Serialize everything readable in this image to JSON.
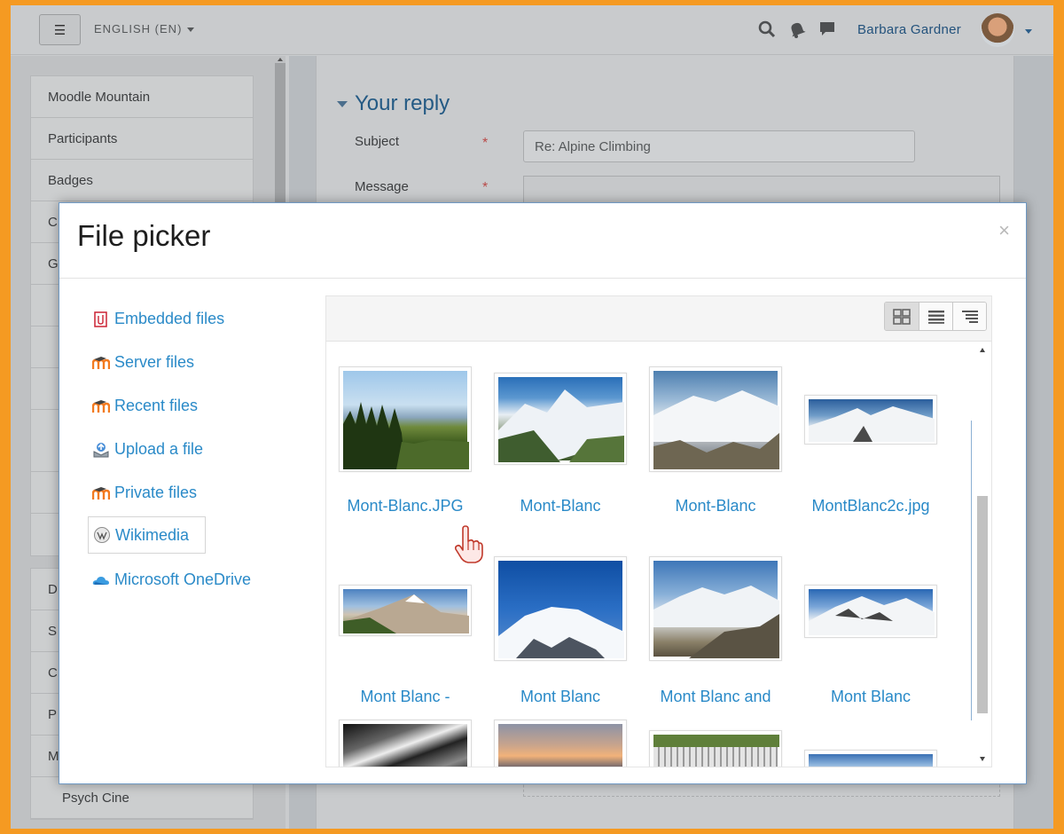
{
  "navbar": {
    "menu_icon": "hamburger-icon",
    "language": "ENGLISH (EN)",
    "icons": [
      "search-icon",
      "bell-icon",
      "chat-icon"
    ],
    "username": "Barbara Gardner"
  },
  "drawer": {
    "items": [
      "Moodle Mountain",
      "Participants",
      "Badges",
      "C",
      "G",
      "",
      "",
      "",
      ""
    ],
    "items2": [
      "D",
      "S",
      "C",
      "P",
      "M",
      "Psych Cine"
    ]
  },
  "form": {
    "section_title": "Your reply",
    "subject_label": "Subject",
    "subject_value": "Re: Alpine Climbing",
    "message_label": "Message",
    "required_marker": "*"
  },
  "modal": {
    "title": "File picker",
    "close_label": "×",
    "repositories": [
      {
        "label": "Embedded files",
        "icon": "embedded-files-icon"
      },
      {
        "label": "Server files",
        "icon": "moodle-icon"
      },
      {
        "label": "Recent files",
        "icon": "moodle-icon"
      },
      {
        "label": "Upload a file",
        "icon": "upload-icon"
      },
      {
        "label": "Private files",
        "icon": "moodle-icon"
      },
      {
        "label": "Wikimedia",
        "icon": "wikimedia-icon"
      },
      {
        "label": "Microsoft OneDrive",
        "icon": "onedrive-icon"
      }
    ],
    "active_repository": "Wikimedia",
    "view_buttons": [
      "grid-view-icon",
      "list-view-icon",
      "tree-view-icon"
    ],
    "files": [
      {
        "name": "Mont-Blanc.JPG"
      },
      {
        "name": "Mont-Blanc"
      },
      {
        "name": "Mont-Blanc"
      },
      {
        "name": "MontBlanc2c.jpg"
      },
      {
        "name": "Mont Blanc -"
      },
      {
        "name": "Mont Blanc"
      },
      {
        "name": "Mont Blanc and"
      },
      {
        "name": "Mont Blanc"
      },
      {
        "name": ""
      },
      {
        "name": ""
      },
      {
        "name": ""
      },
      {
        "name": ""
      }
    ]
  }
}
